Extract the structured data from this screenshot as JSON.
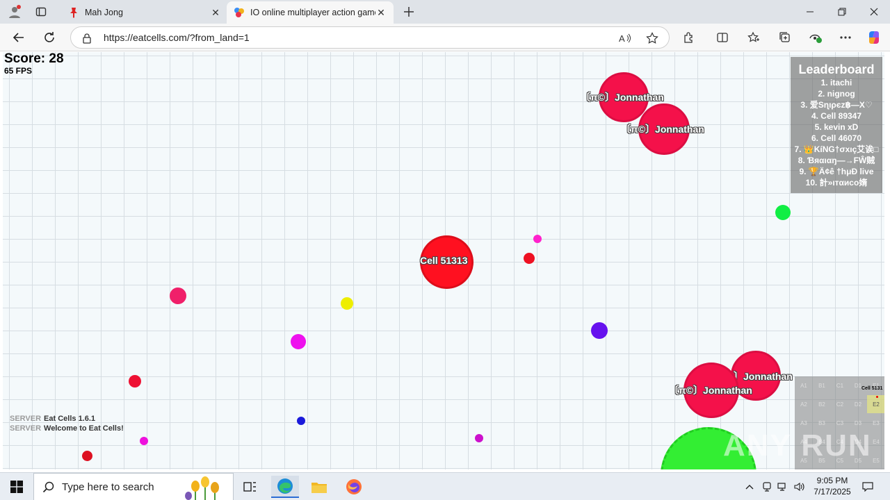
{
  "browser": {
    "tabs": [
      {
        "title": "Mah Jong",
        "active": false
      },
      {
        "title": "IO online multiplayer action game",
        "active": true
      }
    ],
    "url": "https://eatcells.com/?from_land=1"
  },
  "game": {
    "score": "Score: 28",
    "fps": "65 FPS",
    "cells": [
      {
        "label": "Cell 51313"
      },
      {
        "label": "〔π©〕Jonnathan"
      },
      {
        "label": "〔π©〕Jonnathan"
      },
      {
        "label": "〔π©〕Jonnathan"
      },
      {
        "label": "〕Jonnathan"
      }
    ],
    "leaderboard": {
      "title": "Leaderboard",
      "entries": [
        "1. itachi",
        "2. nignog",
        "3. 爱Sɳıρєz฿—X♡",
        "4. Cell 89347",
        "5. kevin xD",
        "6. Cell 46070",
        "7. 👑KíNG†σxıç艾诶□",
        "8. Ɓяαιαŋ—→FŴ贼",
        "9. 🏆Ä¢ê †hμĐ live",
        "10. 計»ıтαиco媠"
      ]
    },
    "chat": [
      {
        "sender": "SERVER",
        "message": "Eat Cells 1.6.1"
      },
      {
        "sender": "SERVER",
        "message": "Welcome to Eat Cells!"
      }
    ],
    "minimap": {
      "rows": [
        [
          "A1",
          "B1",
          "C1",
          "D1",
          "E1"
        ],
        [
          "A2",
          "B2",
          "C2",
          "D2",
          "E2"
        ],
        [
          "A3",
          "B3",
          "C3",
          "D3",
          "E3"
        ],
        [
          "A4",
          "B4",
          "C4",
          "D4",
          "E4"
        ],
        [
          "A5",
          "B5",
          "C5",
          "D5",
          "E5"
        ]
      ],
      "player_label": "Cell 5131",
      "highlight": "E2"
    },
    "watermark": "ANY RUN"
  },
  "taskbar": {
    "search_placeholder": "Type here to search",
    "time": "9:05 PM",
    "date": "7/17/2025"
  },
  "colors": {
    "player": "#ff1020",
    "enemy": "#f4114a",
    "virus": "#33ee33"
  }
}
